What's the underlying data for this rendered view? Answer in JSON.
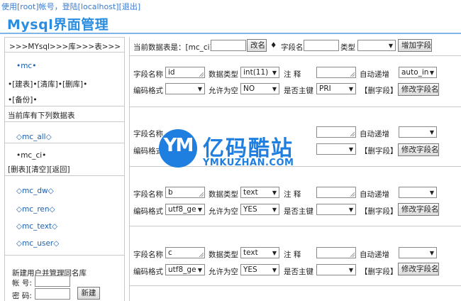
{
  "header": {
    "login_info": "使用[root]帐号，登陆[localhost][退出]",
    "title": "Mysql界面管理"
  },
  "sidebar": {
    "breadcrumb": ">>>MYsql>>>库>>>表>>>",
    "db_name": "•mc•",
    "db_actions": "•[建表]•[清库]•[删库]•",
    "backup": "•[备份]•",
    "table_list_title": "当前库有下列数据表",
    "tables": [
      {
        "label": "◇mc_all◇"
      },
      {
        "label": "•mc_ci•"
      }
    ],
    "selected_actions": "[删表][清空][返回]",
    "tables_more": [
      {
        "label": "◇mc_dw◇"
      },
      {
        "label": "◇mc_ren◇"
      },
      {
        "label": "◇mc_text◇"
      },
      {
        "label": "◇mc_user◇"
      }
    ],
    "new_user": {
      "title": "新建用户并管理同名库",
      "account_label": "帐 号:",
      "password_label": "密 码:",
      "create_label": "新建"
    }
  },
  "toolbar": {
    "current_table_label": "当前数据表是：[mc_ci]",
    "rename_label": "改名",
    "diamond": "♦",
    "field_name_label": "字段名",
    "type_label": "类型",
    "add_field_label": "增加字段"
  },
  "labels": {
    "field_name": "字段名称",
    "data_type": "数据类型",
    "note": "注    释",
    "auto_inc": "自动递增",
    "encoding": "编码格式",
    "nullable": "允许为空",
    "primary": "是否主键",
    "delete_field": "【删字段】",
    "modify_field": "修改字段名"
  },
  "fields": [
    {
      "name": "id",
      "type": "int(11)",
      "auto": "auto_in",
      "encoding": "",
      "nullable": "NO",
      "primary": "PRI"
    },
    {
      "name": "",
      "type": "",
      "auto": "",
      "encoding": "",
      "nullable": "",
      "primary": ""
    },
    {
      "name": "b",
      "type": "text",
      "auto": "",
      "encoding": "utf8_ge",
      "nullable": "YES",
      "primary": ""
    },
    {
      "name": "c",
      "type": "text",
      "auto": "",
      "encoding": "utf8_ge",
      "nullable": "YES",
      "primary": ""
    }
  ],
  "watermark": {
    "logo_text": "YM",
    "cn": "亿码酷站",
    "en": "YMKUZHAN.COM"
  }
}
